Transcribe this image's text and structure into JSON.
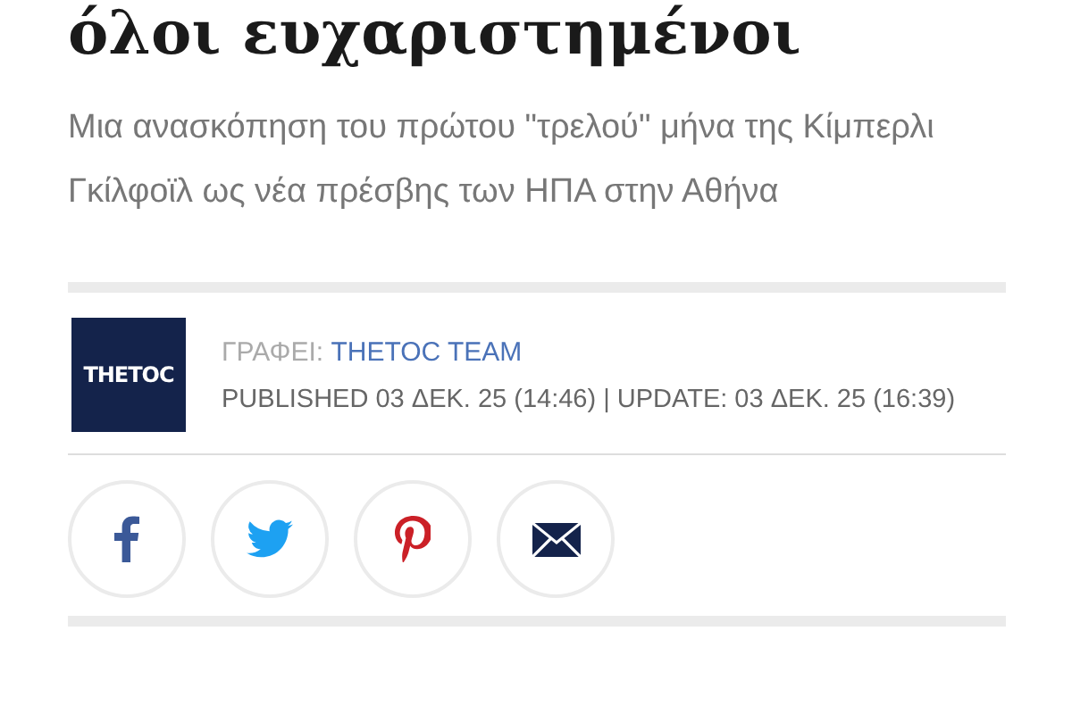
{
  "headline": "όλοι ευχαριστημένοι",
  "summary": "Μια ανασκόπηση του πρώτου \"τρελού\" μήνα της Κίμπερλι Γκίλφοϊλ ως νέα πρέσβης των ΗΠΑ στην Αθήνα",
  "author": {
    "logo": "THETOC",
    "label": "ΓΡΑΦΕΙ:",
    "name": "THETOC TEAM",
    "dates": "PUBLISHED 03 ΔΕΚ. 25 (14:46) | UPDATE: 03 ΔΕΚ. 25 (16:39)"
  },
  "share_buttons": [
    {
      "kind": "facebook"
    },
    {
      "kind": "twitter"
    },
    {
      "kind": "pinterest"
    },
    {
      "kind": "email"
    }
  ]
}
